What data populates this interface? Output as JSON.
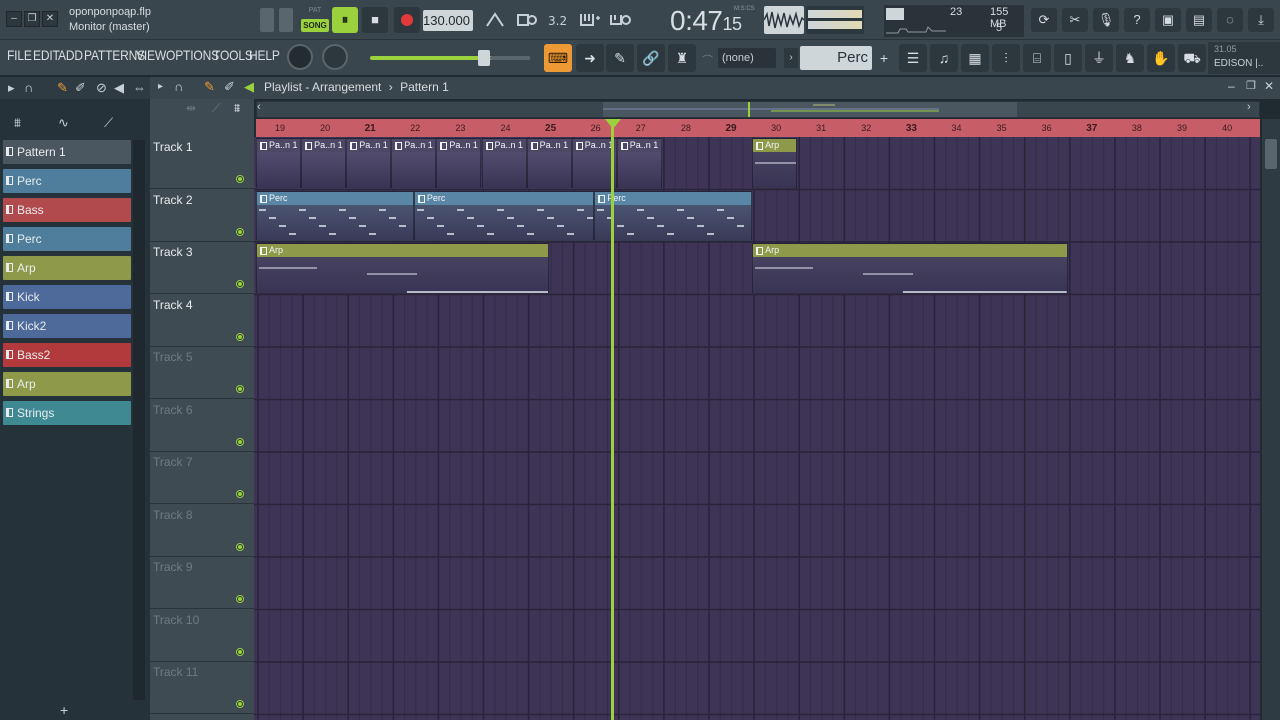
{
  "window": {
    "file_name": "oponponpoąp.flp",
    "monitor": "Monitor (master)",
    "min_label": "–",
    "restore_label": "❐",
    "close_label": "✕"
  },
  "transport": {
    "pat_label": "PAT",
    "song_label": "SONG",
    "play_icon": "⏸",
    "stop_icon": "■",
    "tempo": "130.000",
    "time": "0:47",
    "time_ms": "15",
    "time_unit": "M:S:CS"
  },
  "cpu": {
    "cpu_value": "23",
    "memory": "155 MB",
    "polyphony": "5"
  },
  "menu": {
    "file": "FILE",
    "edit": "EDIT",
    "add": "ADD",
    "patterns": "PATTERNS",
    "view": "VIEW",
    "options": "OPTIONS",
    "tools": "TOOLS",
    "help": "HELP"
  },
  "toolbar": {
    "none_select": "(none)",
    "channel_select": "Perc",
    "add_label": "+",
    "edison_version": "31.05",
    "edison_name": "EDISON |.."
  },
  "playlist": {
    "title": "Playlist - Arrangement",
    "separator": "›",
    "pattern": "Pattern 1",
    "bar_numbers": [
      "19",
      "20",
      "21",
      "22",
      "23",
      "24",
      "25",
      "26",
      "27",
      "28",
      "29",
      "30",
      "31",
      "32",
      "33",
      "34",
      "35",
      "36",
      "37",
      "38",
      "39",
      "40"
    ],
    "tracks": [
      {
        "name": "Track 1",
        "dim": false
      },
      {
        "name": "Track 2",
        "dim": false
      },
      {
        "name": "Track 3",
        "dim": false
      },
      {
        "name": "Track 4",
        "dim": false
      },
      {
        "name": "Track 5",
        "dim": true
      },
      {
        "name": "Track 6",
        "dim": true
      },
      {
        "name": "Track 7",
        "dim": true
      },
      {
        "name": "Track 8",
        "dim": true
      },
      {
        "name": "Track 9",
        "dim": true
      },
      {
        "name": "Track 10",
        "dim": true
      },
      {
        "name": "Track 11",
        "dim": true
      }
    ],
    "clips": [
      {
        "track": 0,
        "start": 19,
        "end": 20,
        "label": "Pa..n 1",
        "type": "pattern"
      },
      {
        "track": 0,
        "start": 20,
        "end": 21,
        "label": "Pa..n 1",
        "type": "pattern"
      },
      {
        "track": 0,
        "start": 21,
        "end": 22,
        "label": "Pa..n 1",
        "type": "pattern"
      },
      {
        "track": 0,
        "start": 22,
        "end": 23,
        "label": "Pa..n 1",
        "type": "pattern"
      },
      {
        "track": 0,
        "start": 23,
        "end": 24,
        "label": "Pa..n 1",
        "type": "pattern"
      },
      {
        "track": 0,
        "start": 24,
        "end": 25,
        "label": "Pa..n 1",
        "type": "pattern"
      },
      {
        "track": 0,
        "start": 25,
        "end": 26,
        "label": "Pa..n 1",
        "type": "pattern"
      },
      {
        "track": 0,
        "start": 26,
        "end": 27,
        "label": "Pa..n 1",
        "type": "pattern"
      },
      {
        "track": 0,
        "start": 27,
        "end": 28,
        "label": "Pa..n 1",
        "type": "pattern"
      },
      {
        "track": 0,
        "start": 30,
        "end": 31,
        "label": "Arp",
        "type": "arp"
      },
      {
        "track": 1,
        "start": 19,
        "end": 22.5,
        "label": "Perc",
        "type": "perc"
      },
      {
        "track": 1,
        "start": 22.5,
        "end": 26.5,
        "label": "Perc",
        "type": "perc"
      },
      {
        "track": 1,
        "start": 26.5,
        "end": 30,
        "label": "Perc",
        "type": "perc"
      },
      {
        "track": 2,
        "start": 19,
        "end": 25.5,
        "label": "Arp",
        "type": "arp"
      },
      {
        "track": 2,
        "start": 30,
        "end": 37,
        "label": "Arp",
        "type": "arp"
      }
    ],
    "playhead_bar": 26.45
  },
  "patterns": [
    {
      "name": "Pattern 1",
      "color": "#4a5660"
    },
    {
      "name": "Perc",
      "color": "#4f7e9c"
    },
    {
      "name": "Bass",
      "color": "#b04a4d"
    },
    {
      "name": "Perc",
      "color": "#4f7e9c"
    },
    {
      "name": "Arp",
      "color": "#8e9a4a"
    },
    {
      "name": "Kick",
      "color": "#4e6a9a"
    },
    {
      "name": "Kick2",
      "color": "#4e6a9a"
    },
    {
      "name": "Bass2",
      "color": "#b2393c"
    },
    {
      "name": "Arp",
      "color": "#8e9a4a"
    },
    {
      "name": "Strings",
      "color": "#3f8a92"
    }
  ],
  "colors": {
    "accent_green": "#9ad13d",
    "ruler_red": "#c75e67",
    "grid_purple": "#3d3456",
    "typing_orange": "#ee9a34"
  }
}
